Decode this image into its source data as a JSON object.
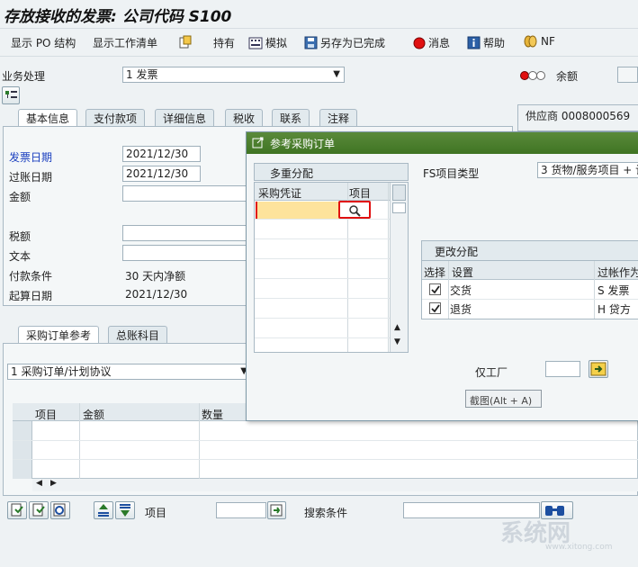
{
  "window": {
    "title": "存放接收的发票: 公司代码 S100"
  },
  "toolbar": {
    "show_po_structure": "显示 PO 结构",
    "show_worklist": "显示工作清单",
    "hold": "持有",
    "simulate": "模拟",
    "save_completed": "另存为已完成",
    "messages": "消息",
    "help": "帮助",
    "nf": "NF"
  },
  "header": {
    "transaction_label": "业务处理",
    "transaction_value": "1 发票",
    "balance_label": "余额"
  },
  "tabs": [
    "基本信息",
    "支付款项",
    "详细信息",
    "税收",
    "联系",
    "注释"
  ],
  "basic": {
    "invoice_date_label": "发票日期",
    "invoice_date_value": "2021/12/30",
    "posting_date_label": "过账日期",
    "posting_date_value": "2021/12/30",
    "amount_label": "金额",
    "tax_label": "税额",
    "text_label": "文本",
    "payment_terms_label": "付款条件",
    "payment_terms_value": "30 天内净额",
    "baseline_date_label": "起算日期",
    "baseline_date_value": "2021/12/30"
  },
  "vendor": {
    "label": "供应商 0008000569"
  },
  "lower_tabs": [
    "采购订单参考",
    "总账科目"
  ],
  "po_ref": {
    "select_value": "1 采购订单/计划协议",
    "columns": [
      "项目",
      "金额",
      "数量"
    ]
  },
  "footer": {
    "item_label": "项目",
    "search_label": "搜索条件"
  },
  "dialog": {
    "title": "参考采购订单",
    "multi_assign_tab": "多重分配",
    "columns": [
      "采购凭证",
      "项目"
    ],
    "fs_item_type_label": "FS项目类型",
    "fs_item_type_value": "3 货物/服务项目 + 计",
    "change_assign_title": "更改分配",
    "assign_columns": [
      "选择",
      "设置",
      "过帐作为"
    ],
    "assign_rows": [
      {
        "checked": true,
        "setting": "交货",
        "post_as": "S 发票"
      },
      {
        "checked": true,
        "setting": "退货",
        "post_as": "H 贷方"
      }
    ],
    "plant_label": "仅工厂",
    "tooltip": "截图(Alt + A)"
  },
  "watermark": {
    "text": "系统网",
    "url": "www.xitong.com"
  },
  "colors": {
    "dialog_title_bg": "#3f7423",
    "highlight_border": "#e01010",
    "active_cell_bg": "#fde39c"
  }
}
